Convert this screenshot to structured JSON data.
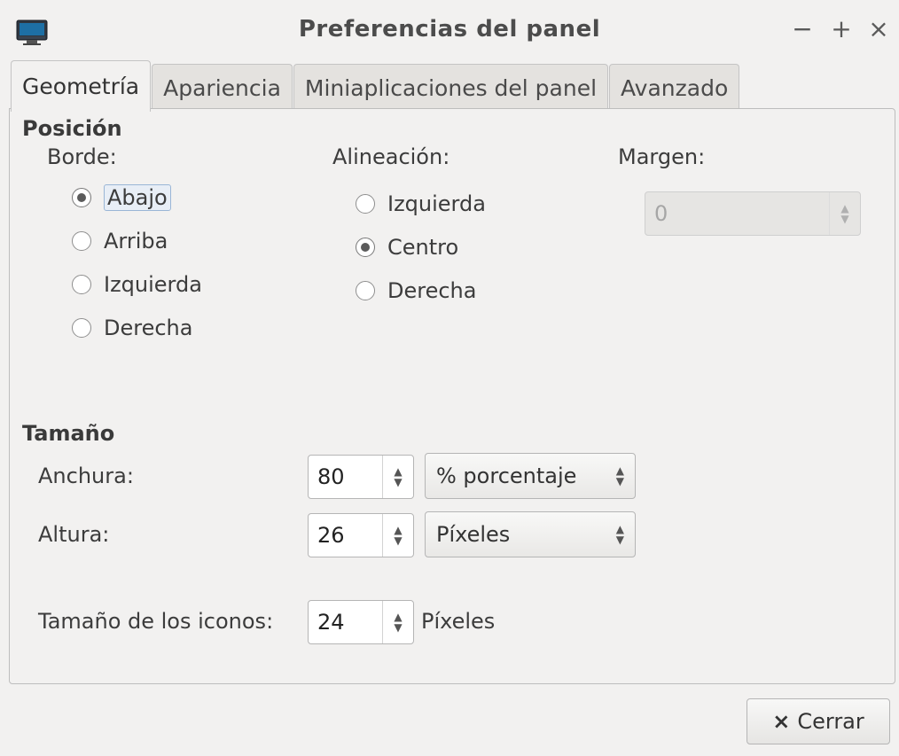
{
  "window": {
    "title": "Preferencias del panel",
    "minimize": "−",
    "maximize": "+",
    "close": "×"
  },
  "tabs": [
    {
      "label": "Geometría",
      "active": true
    },
    {
      "label": "Apariencia",
      "active": false
    },
    {
      "label": "Miniaplicaciones del panel",
      "active": false
    },
    {
      "label": "Avanzado",
      "active": false
    }
  ],
  "position": {
    "title": "Posición",
    "border_label": "Borde:",
    "border_options": [
      "Abajo",
      "Arriba",
      "Izquierda",
      "Derecha"
    ],
    "border_selected": "Abajo",
    "alignment_label": "Alineación:",
    "alignment_options": [
      "Izquierda",
      "Centro",
      "Derecha"
    ],
    "alignment_selected": "Centro",
    "margin_label": "Margen:",
    "margin_value": "0"
  },
  "size": {
    "title": "Tamaño",
    "width_label": "Anchura:",
    "width_value": "80",
    "width_unit": "% porcentaje",
    "height_label": "Altura:",
    "height_value": "26",
    "height_unit": "Píxeles",
    "icon_size_label": "Tamaño de los iconos:",
    "icon_size_value": "24",
    "icon_size_unit": "Píxeles"
  },
  "footer": {
    "close_label": "Cerrar",
    "close_icon": "×"
  },
  "colors": {
    "background": "#f2f1f0",
    "tab_inactive": "#e4e2df",
    "border": "#bdbdbd"
  }
}
